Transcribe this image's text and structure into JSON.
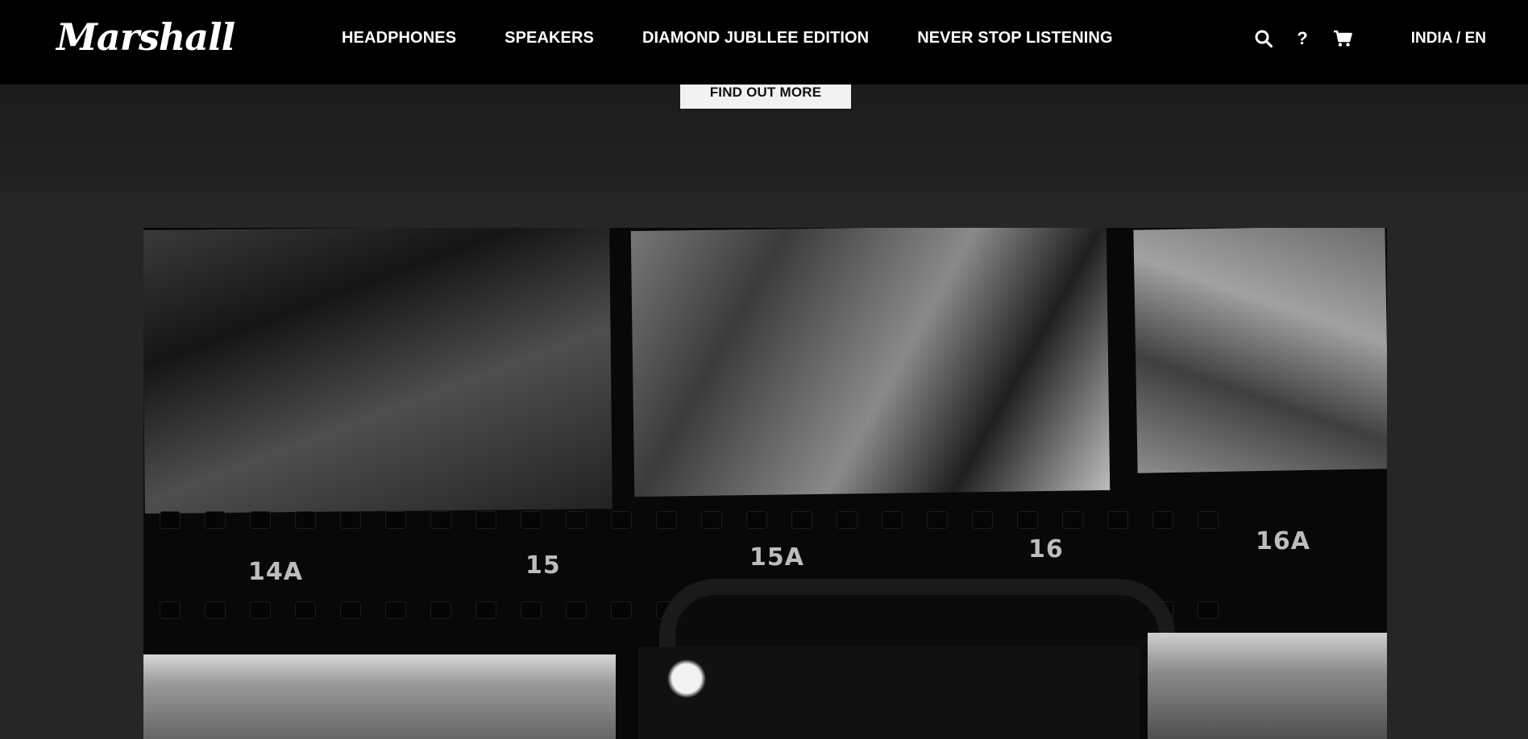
{
  "header": {
    "logo": "Marshall",
    "nav": [
      {
        "label": "HEADPHONES"
      },
      {
        "label": "SPEAKERS"
      },
      {
        "label": "DIAMOND JUBLLEE EDITION"
      },
      {
        "label": "NEVER STOP LISTENING"
      }
    ],
    "icons": [
      "search-icon",
      "help-icon",
      "cart-icon"
    ],
    "help_glyph": "?",
    "locale": "INDIA / EN"
  },
  "hero": {
    "cta_label": "FIND OUT MORE"
  },
  "contact_sheet": {
    "frame_numbers": [
      "14A",
      "15",
      "15A",
      "16",
      "16A"
    ]
  }
}
